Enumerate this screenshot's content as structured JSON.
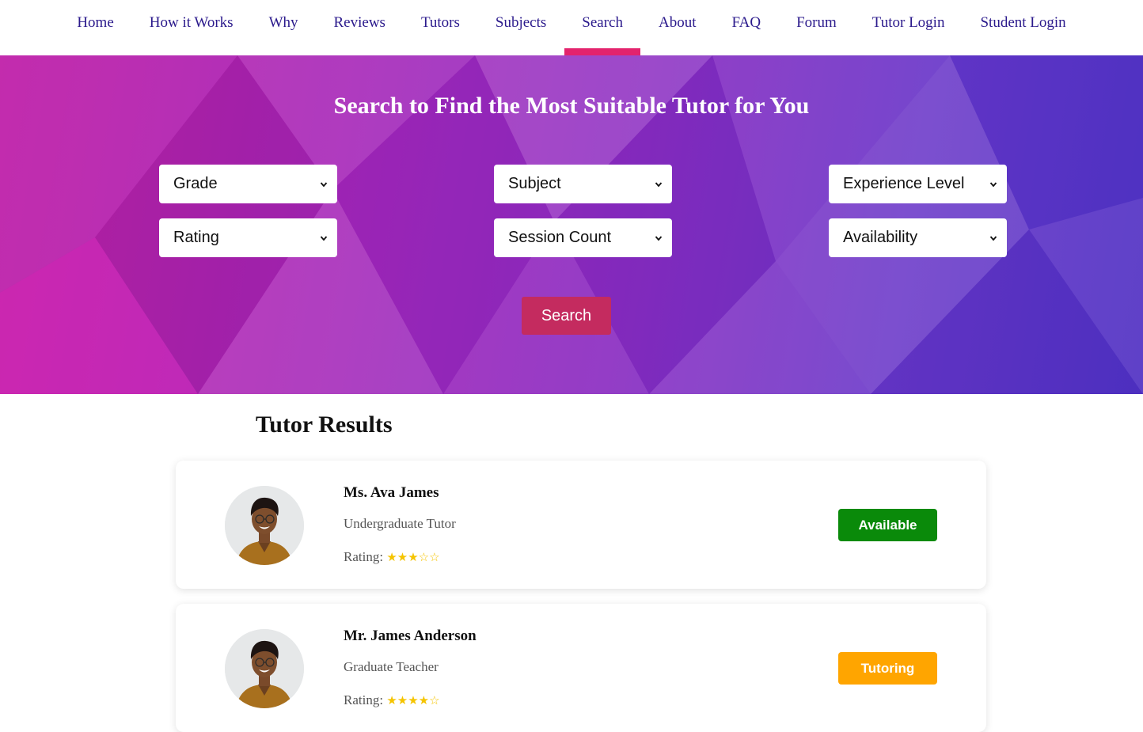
{
  "nav": {
    "items": [
      {
        "label": "Home"
      },
      {
        "label": "How it Works"
      },
      {
        "label": "Why"
      },
      {
        "label": "Reviews"
      },
      {
        "label": "Tutors"
      },
      {
        "label": "Subjects"
      },
      {
        "label": "Search",
        "active": true
      },
      {
        "label": "About"
      },
      {
        "label": "FAQ"
      },
      {
        "label": "Forum"
      },
      {
        "label": "Tutor Login"
      },
      {
        "label": "Student Login"
      }
    ]
  },
  "hero": {
    "title": "Search to Find the Most Suitable Tutor for You",
    "filters": {
      "grade": "Grade",
      "subject": "Subject",
      "experience": "Experience Level",
      "rating": "Rating",
      "session_count": "Session Count",
      "availability": "Availability"
    },
    "search_label": "Search"
  },
  "results": {
    "title": "Tutor Results",
    "tutors": [
      {
        "name": "Ms. Ava James",
        "role": "Undergraduate Tutor",
        "rating_label": "Rating:",
        "rating": 3,
        "rating_max": 5,
        "stars": "★★★☆☆",
        "status": "Available",
        "status_color": "#0a8a0a"
      },
      {
        "name": "Mr. James Anderson",
        "role": "Graduate Teacher",
        "rating_label": "Rating:",
        "rating": 4,
        "rating_max": 5,
        "stars": "★★★★☆",
        "status": "Tutoring",
        "status_color": "#ffa500"
      }
    ]
  },
  "colors": {
    "nav_text": "#2b1a8c",
    "nav_active_underline": "#e3236d",
    "search_button": "#c42b5f",
    "star": "#f5c400"
  }
}
